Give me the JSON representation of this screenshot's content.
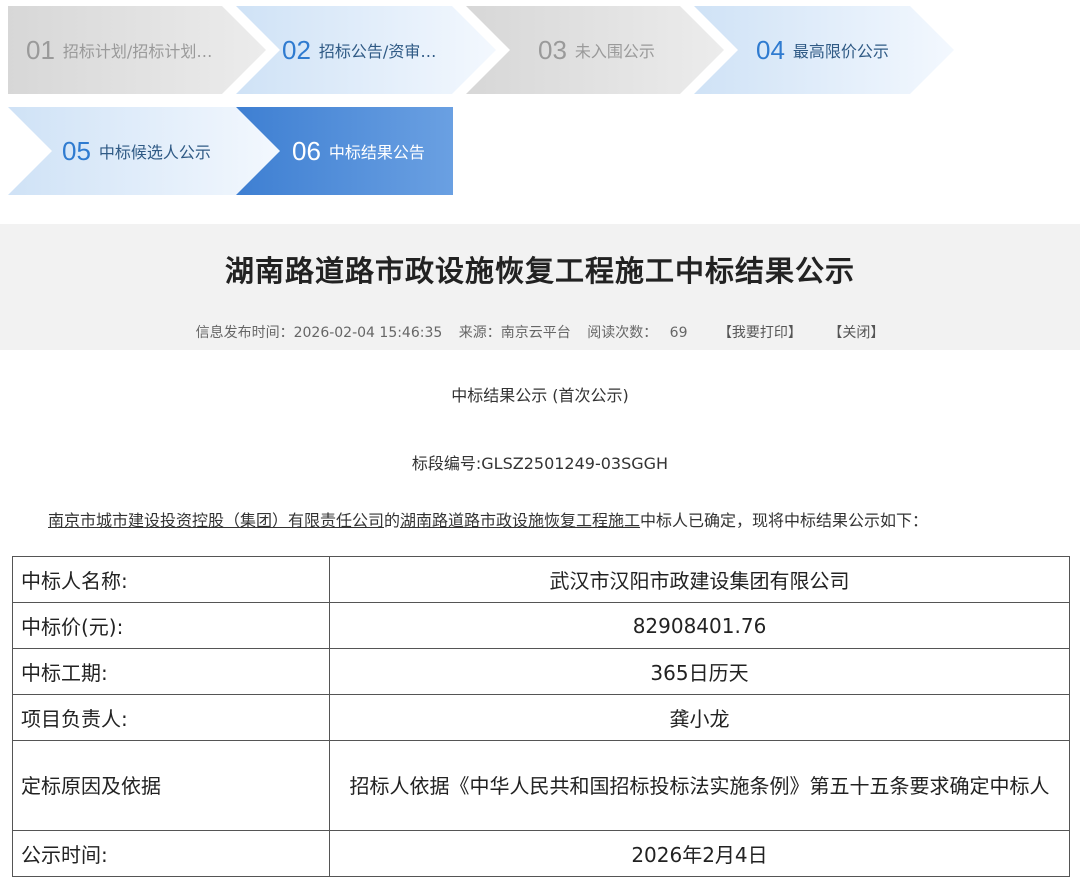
{
  "steps": [
    {
      "num": "01",
      "label": "招标计划/招标计划…",
      "state": "gray"
    },
    {
      "num": "02",
      "label": "招标公告/资审…",
      "state": "light"
    },
    {
      "num": "03",
      "label": "未入围公示",
      "state": "gray"
    },
    {
      "num": "04",
      "label": "最高限价公示",
      "state": "light"
    },
    {
      "num": "05",
      "label": "中标候选人公示",
      "state": "light"
    },
    {
      "num": "06",
      "label": "中标结果公告",
      "state": "active"
    }
  ],
  "header": {
    "title": "湖南路道路市政设施恢复工程施工中标结果公示",
    "publish_label": "信息发布时间：",
    "publish_time": "2026-02-04 15:46:35",
    "source_label": "来源：",
    "source": "南京云平台",
    "views_label": "阅读次数：",
    "views": "69",
    "print_button": "【我要打印】",
    "close_button": "【关闭】"
  },
  "body": {
    "subtitle": "中标结果公示 (首次公示)",
    "section_no": "标段编号:GLSZ2501249-03SGGH",
    "intro_tenderer": "南京市城市建设投资控股（集团）有限责任公司",
    "intro_of": "的",
    "intro_project": "湖南路道路市政设施恢复工程施工",
    "intro_rest": "中标人已确定，现将中标结果公示如下："
  },
  "table": {
    "rows": [
      {
        "key": "中标人名称:",
        "value": "武汉市汉阳市政建设集团有限公司"
      },
      {
        "key": "中标价(元):",
        "value": "82908401.76"
      },
      {
        "key": "中标工期:",
        "value": "365日历天"
      },
      {
        "key": "项目负责人:",
        "value": "龚小龙"
      },
      {
        "key": "定标原因及依据",
        "value": "招标人依据《中华人民共和国招标投标法实施条例》第五十五条要求确定中标人"
      },
      {
        "key": "公示时间:",
        "value": "2026年2月4日"
      }
    ]
  }
}
